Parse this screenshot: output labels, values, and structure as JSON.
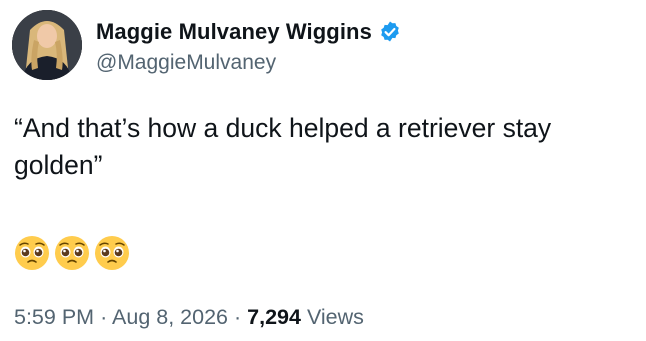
{
  "author": {
    "display_name": "Maggie Mulvaney Wiggins",
    "handle": "@MaggieMulvaney",
    "verified": true,
    "verified_color": "#1d9bf0"
  },
  "tweet": {
    "text": "“And that’s how a duck helped a retriever stay golden”",
    "emojis": [
      "pleading-face-emoji",
      "pleading-face-emoji",
      "pleading-face-emoji"
    ]
  },
  "meta": {
    "time": "5:59 PM",
    "separator": "·",
    "date": "Aug 8, 2026",
    "views_count": "7,294",
    "views_label": "Views"
  },
  "colors": {
    "text_primary": "#0f1419",
    "text_secondary": "#536471",
    "background": "#ffffff"
  }
}
